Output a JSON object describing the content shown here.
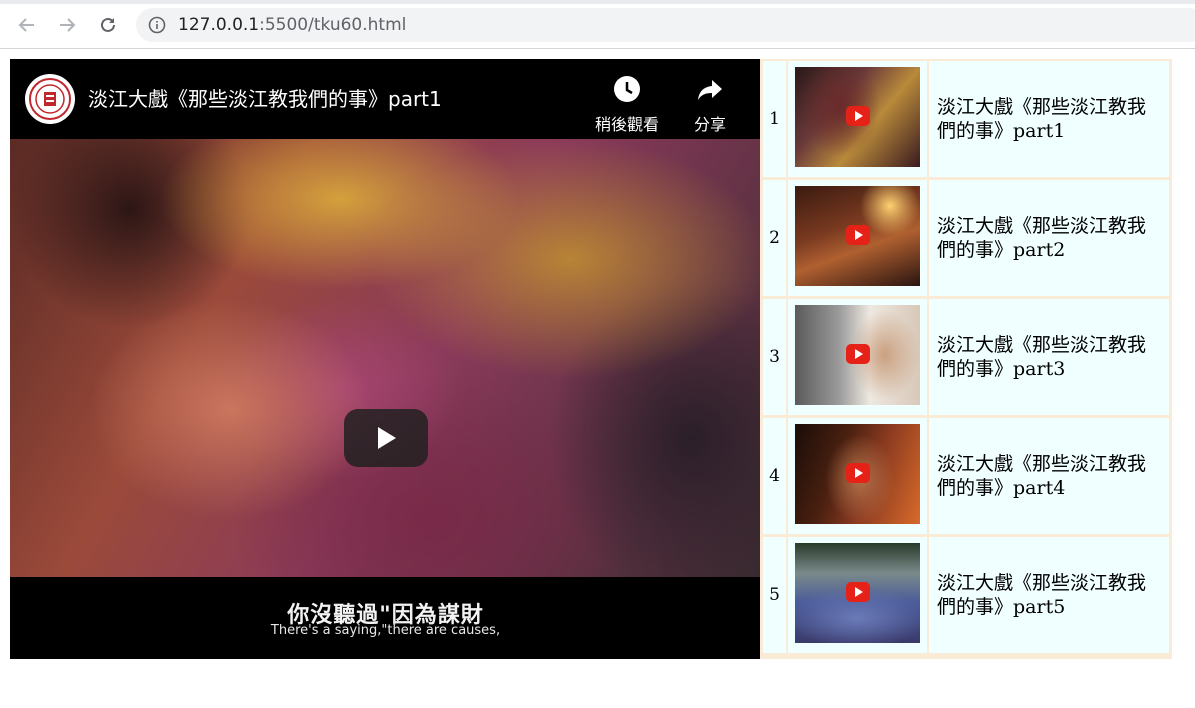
{
  "browser": {
    "url_host": "127.0.0.1",
    "url_rest": ":5500/tku60.html"
  },
  "player": {
    "title": "淡江大戲《那些淡江教我們的事》part1",
    "watch_later_label": "稍後觀看",
    "share_label": "分享",
    "subtitle_zh": "你沒聽過\"因為謀財",
    "subtitle_en": "There's a saying,\"there are causes,"
  },
  "playlist": [
    {
      "num": "1",
      "title": "淡江大戲《那些淡江教我們的事》part1"
    },
    {
      "num": "2",
      "title": "淡江大戲《那些淡江教我們的事》part2"
    },
    {
      "num": "3",
      "title": "淡江大戲《那些淡江教我們的事》part3"
    },
    {
      "num": "4",
      "title": "淡江大戲《那些淡江教我們的事》part4"
    },
    {
      "num": "5",
      "title": "淡江大戲《那些淡江教我們的事》part5"
    }
  ],
  "colors": {
    "table_border": "#faebd7",
    "cell_bg": "#f0ffff"
  }
}
